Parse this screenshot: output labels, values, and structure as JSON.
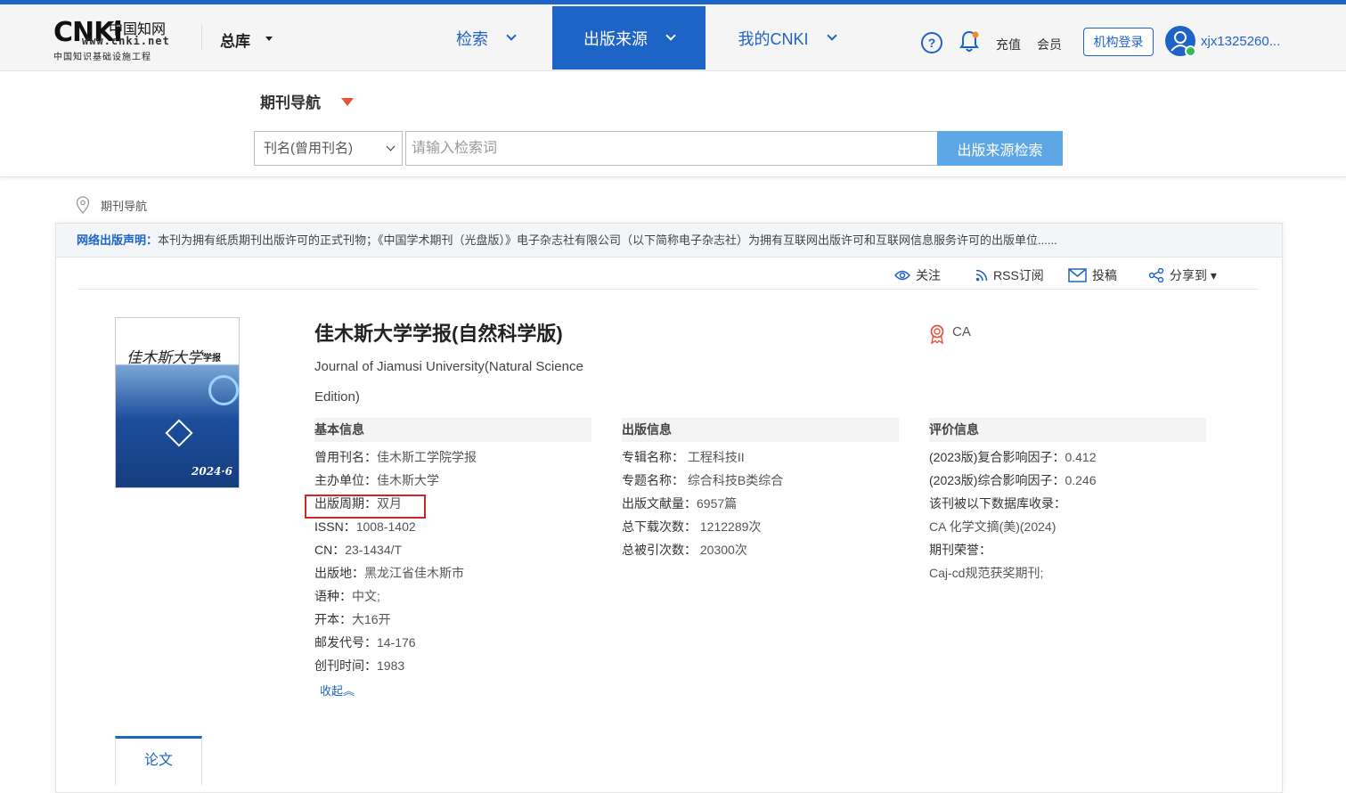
{
  "header": {
    "logo_main": "CNKi",
    "logo_cn": "中国知网",
    "logo_url": "www.cnki.net",
    "logo_sub": "中国知识基础设施工程",
    "library_label": "总库",
    "nav": [
      "检索",
      "出版来源",
      "我的CNKI"
    ],
    "help_icon": "?",
    "recharge_label": "充值",
    "member_label": "会员",
    "institution_login_label": "机构登录",
    "username": "xjx1325260..."
  },
  "search": {
    "journal_nav_label": "期刊导航",
    "field_select": "刊名(曾用刊名)",
    "placeholder": "请输入检索词",
    "button_label": "出版来源检索"
  },
  "breadcrumb": "期刊导航",
  "notice": {
    "label": "网络出版声明：",
    "text": "本刊为拥有纸质期刊出版许可的正式刊物；《中国学术期刊（光盘版）》电子杂志社有限公司（以下简称电子杂志社）为拥有互联网出版许可和互联网信息服务许可的出版单位......"
  },
  "actions": {
    "follow": "关注",
    "rss": "RSS订阅",
    "submit": "投稿",
    "share": "分享到 ▾"
  },
  "cover": {
    "title": "佳木斯大学",
    "title2": "学报",
    "issue": "2024·6"
  },
  "journal": {
    "title": "佳木斯大学学报(自然科学版)",
    "title_en": "Journal of Jiamusi University(Natural Science Edition)",
    "index_badge": "CA"
  },
  "basic_info": {
    "heading": "基本信息",
    "rows": [
      {
        "k": "曾用刊名：",
        "v": "佳木斯工学院学报"
      },
      {
        "k": "主办单位：",
        "v": "佳木斯大学"
      },
      {
        "k": "出版周期：",
        "v": "双月"
      },
      {
        "k": "ISSN：",
        "v": "1008-1402"
      },
      {
        "k": "CN：",
        "v": "23-1434/T"
      },
      {
        "k": "出版地：",
        "v": "黑龙江省佳木斯市"
      },
      {
        "k": "语种：",
        "v": "中文;"
      },
      {
        "k": "开本：",
        "v": "大16开"
      },
      {
        "k": "邮发代号：",
        "v": "14-176"
      },
      {
        "k": "创刊时间：",
        "v": "1983"
      }
    ],
    "collapse_label": "收起︽"
  },
  "pub_info": {
    "heading": "出版信息",
    "rows": [
      {
        "k": "专辑名称：",
        "v": " 工程科技II"
      },
      {
        "k": "专题名称：",
        "v": " 综合科技B类综合"
      },
      {
        "k": "出版文献量：",
        "v": "6957篇"
      },
      {
        "k": "总下载次数：",
        "v": " 1212289次"
      },
      {
        "k": "总被引次数：",
        "v": " 20300次"
      }
    ]
  },
  "eval_info": {
    "heading": "评价信息",
    "rows": [
      {
        "k": "(2023版)复合影响因子：",
        "v": "0.412"
      },
      {
        "k": "(2023版)综合影响因子：",
        "v": "0.246"
      },
      {
        "k": "该刊被以下数据库收录：",
        "v": ""
      },
      {
        "k": "",
        "v": "CA 化学文摘(美)(2024)"
      },
      {
        "k": "期刊荣誉：",
        "v": ""
      },
      {
        "k": "",
        "v": "Caj-cd规范获奖期刊;"
      }
    ]
  },
  "tabs": {
    "paper": "论文"
  }
}
